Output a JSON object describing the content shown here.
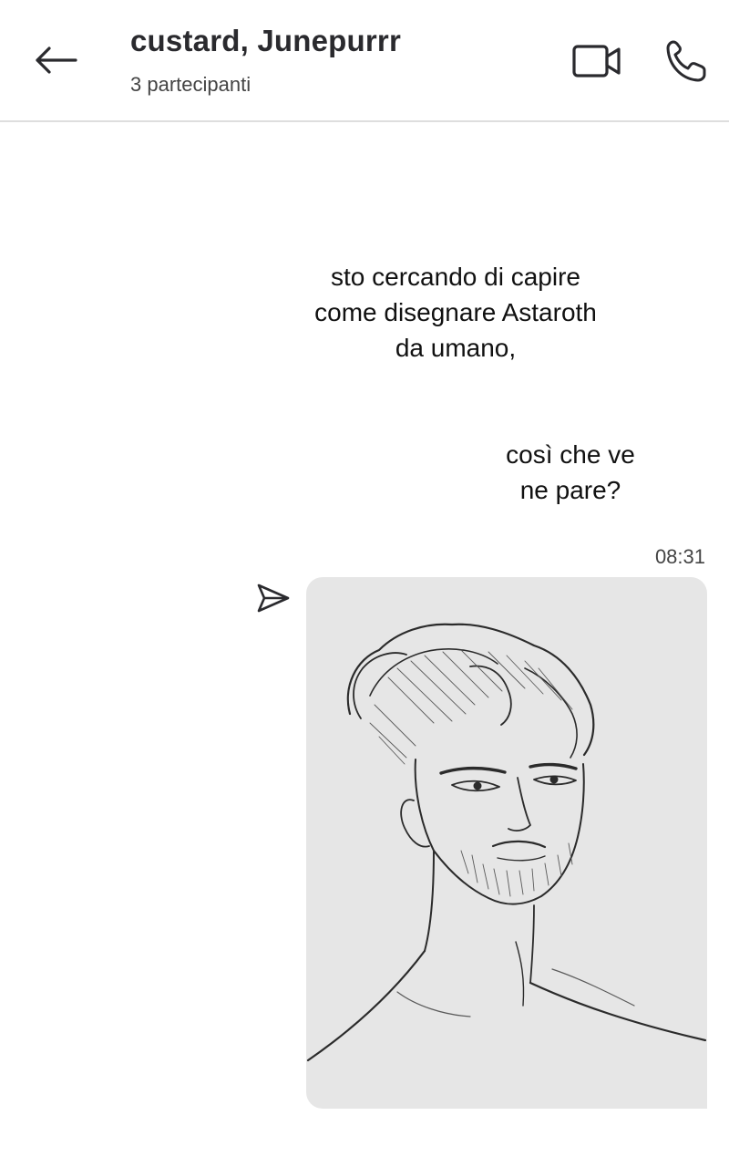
{
  "header": {
    "title": "custard, Junepurrr",
    "subtitle": "3 partecipanti",
    "back_icon": "arrow-left-icon",
    "video_icon": "video-camera-icon",
    "call_icon": "phone-icon"
  },
  "messages": [
    {
      "lines": [
        "sto cercando di capire",
        "come disegnare Astaroth",
        "da umano,"
      ]
    },
    {
      "lines": [
        "così che ve",
        "ne pare?"
      ]
    }
  ],
  "image_message": {
    "timestamp": "08:31",
    "status_icon": "sent-paper-plane-icon",
    "content": "sketch-image"
  },
  "colors": {
    "header_border": "#dedede",
    "image_bg": "#e6e6e6",
    "icon_stroke": "#2a2a2e"
  }
}
